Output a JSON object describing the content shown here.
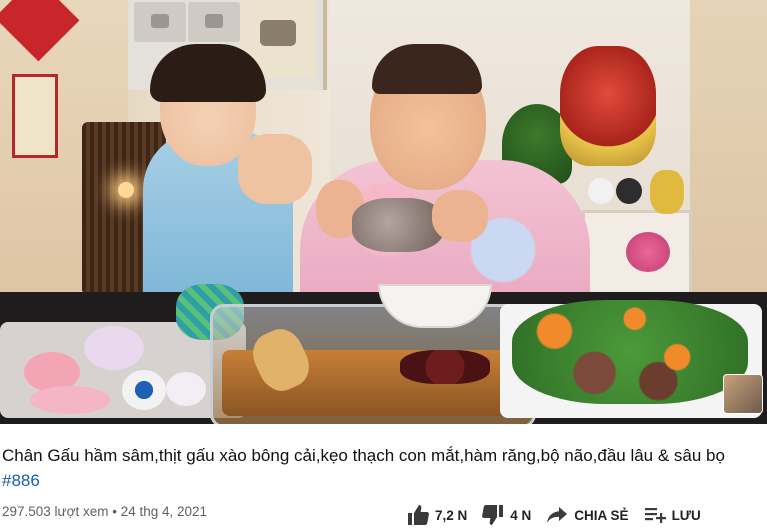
{
  "video": {
    "title": "Chân Gấu hầm sâm,thịt gấu xào bông cải,kẹo thạch con mắt,hàm răng,bộ não,đầu lâu & sâu bọ",
    "hashtag": "#886",
    "views": "297.503 lượt xem",
    "separator": "•",
    "date": "24 thg 4, 2021"
  },
  "actions": {
    "like_count": "7,2 N",
    "dislike_count": "4 N",
    "share_label": "CHIA SẺ",
    "save_label": "LƯU"
  },
  "icons": {
    "like": "thumbs-up-icon",
    "dislike": "thumbs-down-icon",
    "share": "share-arrow-icon",
    "save": "add-to-playlist-icon"
  },
  "colors": {
    "hashtag": "#1a5db4",
    "meta_text": "#606060",
    "title_text": "#111111",
    "icon": "#3a3a3a"
  }
}
